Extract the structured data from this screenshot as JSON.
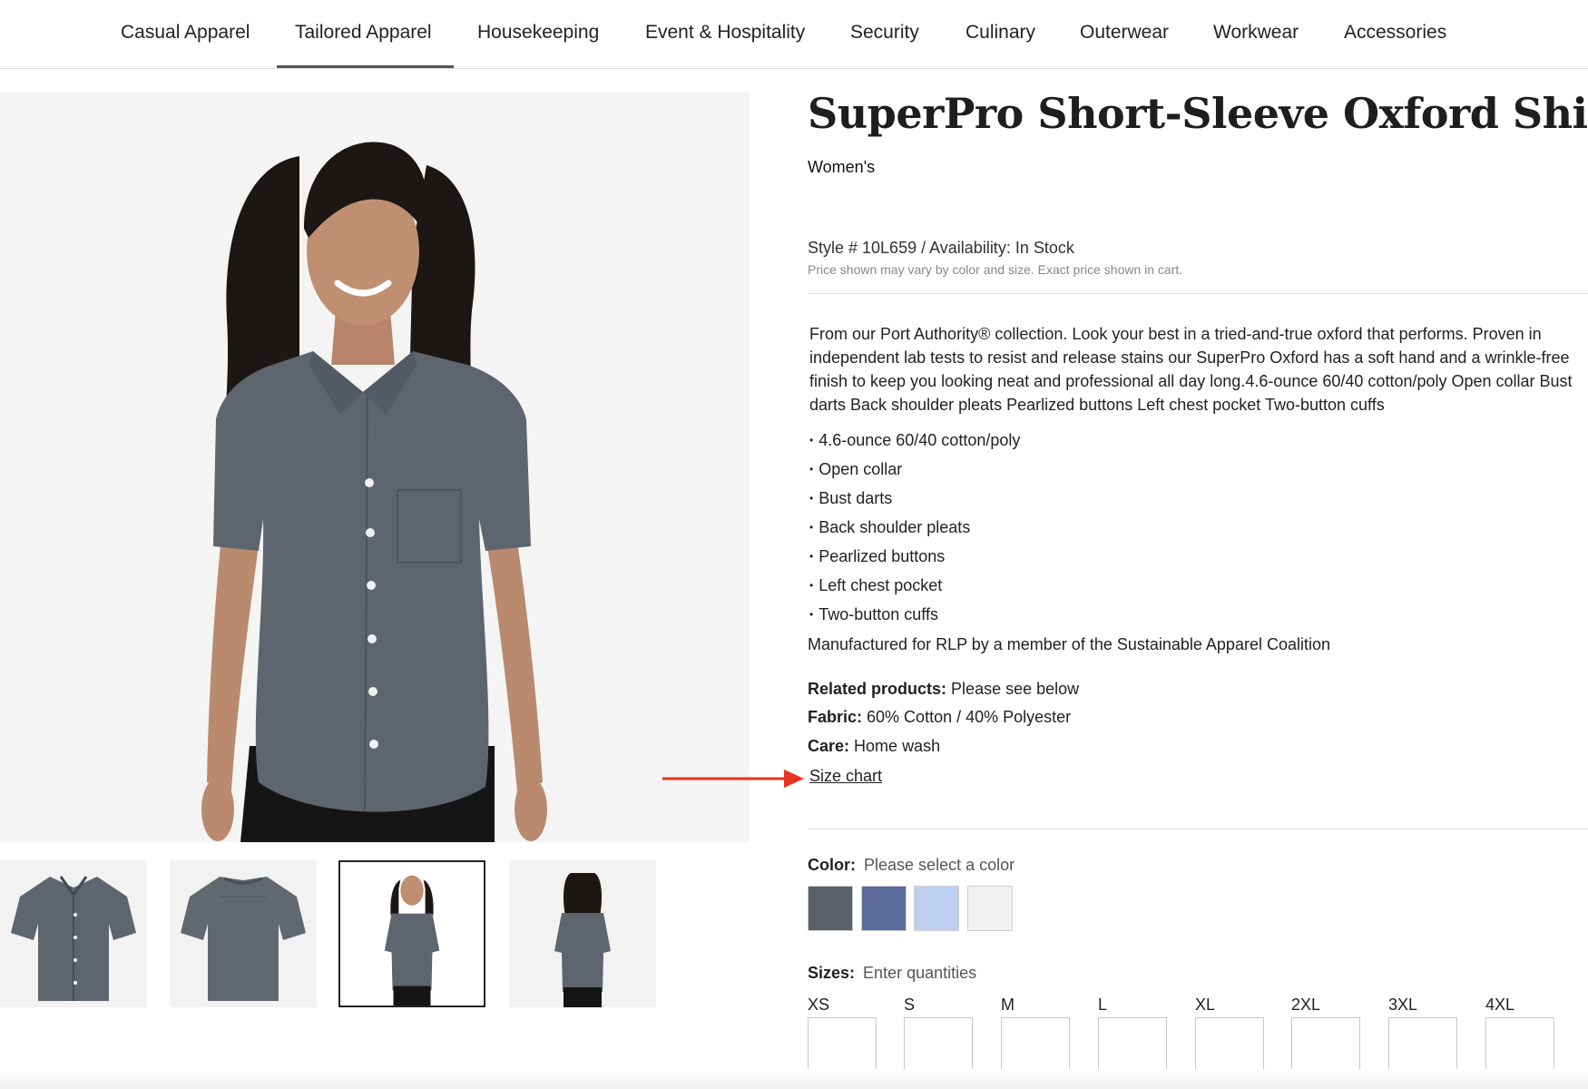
{
  "nav": {
    "items": [
      "Casual Apparel",
      "Tailored Apparel",
      "Housekeeping",
      "Event & Hospitality",
      "Security",
      "Culinary",
      "Outerwear",
      "Workwear",
      "Accessories"
    ],
    "active": "Tailored Apparel"
  },
  "product": {
    "title": "SuperPro Short-Sleeve Oxford Shirt",
    "subtitle": "Women's",
    "style_line": "Style # 10L659 / Availability: In Stock",
    "price_note": "Price shown may vary by color and size. Exact price shown in cart.",
    "description": "From our Port Authority® collection. Look your best in a tried-and-true oxford that performs. Proven in independent lab tests to resist and release stains our SuperPro Oxford has a soft hand and a wrinkle-free finish to keep you looking neat and professional all day long.4.6-ounce 60/40 cotton/poly Open collar Bust darts Back shoulder pleats Pearlized buttons Left chest pocket Two-button cuffs",
    "features": [
      "4.6-ounce 60/40 cotton/poly",
      "Open collar",
      "Bust darts",
      "Back shoulder pleats",
      "Pearlized buttons",
      "Left chest pocket",
      "Two-button cuffs"
    ],
    "manufactured": "Manufactured for RLP by a member of the Sustainable Apparel Coalition",
    "related_label": "Related products:",
    "related_value": "Please see below",
    "fabric_label": "Fabric:",
    "fabric_value": "60% Cotton / 40% Polyester",
    "care_label": "Care:",
    "care_value": "Home wash",
    "size_chart_link": "Size chart"
  },
  "color": {
    "label": "Color:",
    "hint": "Please select a color",
    "swatches": [
      "#5b5f69",
      "#5b6b9c",
      "#bccfee",
      "#f1f1ef"
    ]
  },
  "sizes": {
    "label": "Sizes:",
    "hint": "Enter quantities",
    "list": [
      "XS",
      "S",
      "M",
      "L",
      "XL",
      "2XL",
      "3XL",
      "4XL"
    ]
  },
  "gallery": {
    "thumbnails": [
      "front-flat",
      "back-flat",
      "model-front",
      "model-back"
    ],
    "selected_thumbnail": 2
  },
  "colors": {
    "annotation_arrow": "#e8321f",
    "shirt": "#5f656e"
  }
}
